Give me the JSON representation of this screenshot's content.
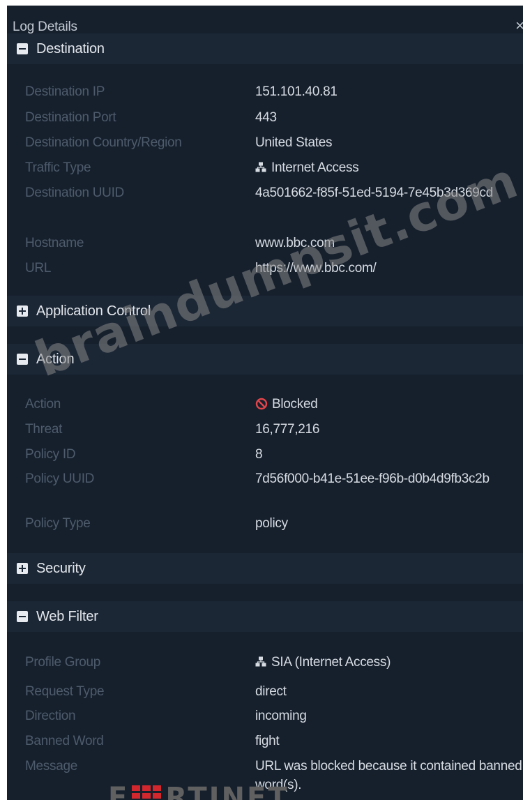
{
  "panel": {
    "title": "Log Details",
    "close_glyph": "×"
  },
  "sections": {
    "destination": {
      "title": "Destination",
      "toggle": "collapse",
      "rows": [
        {
          "label": "Destination IP",
          "value": "151.101.40.81"
        },
        {
          "label": "Destination Port",
          "value": "443"
        },
        {
          "label": "Destination Country/Region",
          "value": "United States"
        },
        {
          "label": "Traffic Type",
          "value": "Internet Access",
          "icon": "network-icon"
        },
        {
          "label": "Destination UUID",
          "value": "4a501662-f85f-51ed-5194-7e45b3d369cd"
        },
        {
          "label": "Hostname",
          "value": "www.bbc.com"
        },
        {
          "label": "URL",
          "value": "https://www.bbc.com/"
        }
      ]
    },
    "application_control": {
      "title": "Application Control",
      "toggle": "expand"
    },
    "action": {
      "title": "Action",
      "toggle": "collapse",
      "rows": [
        {
          "label": "Action",
          "value": "Blocked",
          "icon": "blocked-icon"
        },
        {
          "label": "Threat",
          "value": "16,777,216"
        },
        {
          "label": "Policy ID",
          "value": "8"
        },
        {
          "label": "Policy UUID",
          "value": "7d56f000-b41e-51ee-f96b-d0b4d9fb3c2b"
        },
        {
          "label": "Policy Type",
          "value": "policy"
        }
      ]
    },
    "security": {
      "title": "Security",
      "toggle": "expand"
    },
    "web_filter": {
      "title": "Web Filter",
      "toggle": "collapse",
      "rows": [
        {
          "label": "Profile Group",
          "value": "SIA (Internet Access)",
          "icon": "network-icon"
        },
        {
          "label": "Request Type",
          "value": "direct"
        },
        {
          "label": "Direction",
          "value": "incoming"
        },
        {
          "label": "Banned Word",
          "value": "fight"
        },
        {
          "label": "Message",
          "value": "URL was blocked because it contained banned word(s)."
        }
      ]
    }
  },
  "watermark": "braindumpsit.com",
  "brand_logo": "F  RTINET",
  "colors": {
    "panel_bg": "#16202d",
    "section_header_bg": "#1c2736",
    "label_text": "#4e5b6b",
    "value_text": "#d7dce2",
    "blocked_red": "#e2454a",
    "brand_red": "#d3272e"
  }
}
